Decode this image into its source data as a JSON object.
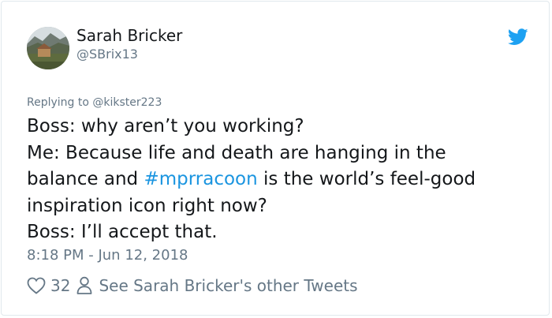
{
  "tweet": {
    "author_name": "Sarah Bricker",
    "author_handle": "@SBrix13",
    "reply_prefix": "Replying to ",
    "reply_to": "@kikster223",
    "text_lines": [
      "Boss: why aren’t you working?",
      "Me: Because life and death are hanging in the",
      "balance and ",
      "#mprracoon",
      " is the world’s feel-good",
      "inspiration icon right now?",
      "Boss: I’ll accept that."
    ],
    "timestamp": "8:18 PM - Jun 12, 2018",
    "likes": "32",
    "other_tweets_link": "See Sarah Bricker's other Tweets"
  },
  "icons": {
    "brand": "twitter-bird-icon",
    "like": "heart-icon",
    "profile": "person-icon"
  },
  "colors": {
    "brand_blue": "#1da1f2",
    "hashtag_blue": "#1b95e0",
    "text": "#14171a",
    "muted": "#657786",
    "border": "#e1e8ed"
  }
}
